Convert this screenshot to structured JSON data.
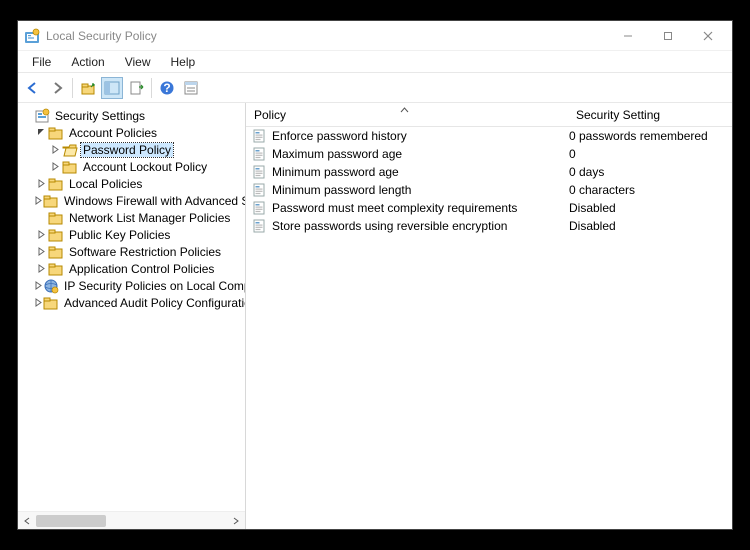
{
  "window": {
    "title": "Local Security Policy"
  },
  "menus": {
    "file": "File",
    "action": "Action",
    "view": "View",
    "help": "Help"
  },
  "tree": {
    "root": "Security Settings",
    "account_policies": "Account Policies",
    "password_policy": "Password Policy",
    "account_lockout": "Account Lockout Policy",
    "local_policies": "Local Policies",
    "fw": "Windows Firewall with Advanced Security",
    "nlm": "Network List Manager Policies",
    "pkp": "Public Key Policies",
    "srp": "Software Restriction Policies",
    "acp": "Application Control Policies",
    "ipsec": "IP Security Policies on Local Computer",
    "audit": "Advanced Audit Policy Configuration"
  },
  "columns": {
    "policy": "Policy",
    "setting": "Security Setting"
  },
  "rows": [
    {
      "name": "Enforce password history",
      "value": "0 passwords remembered"
    },
    {
      "name": "Maximum password age",
      "value": "0"
    },
    {
      "name": "Minimum password age",
      "value": "0 days"
    },
    {
      "name": "Minimum password length",
      "value": "0 characters"
    },
    {
      "name": "Password must meet complexity requirements",
      "value": "Disabled"
    },
    {
      "name": "Store passwords using reversible encryption",
      "value": "Disabled"
    }
  ]
}
